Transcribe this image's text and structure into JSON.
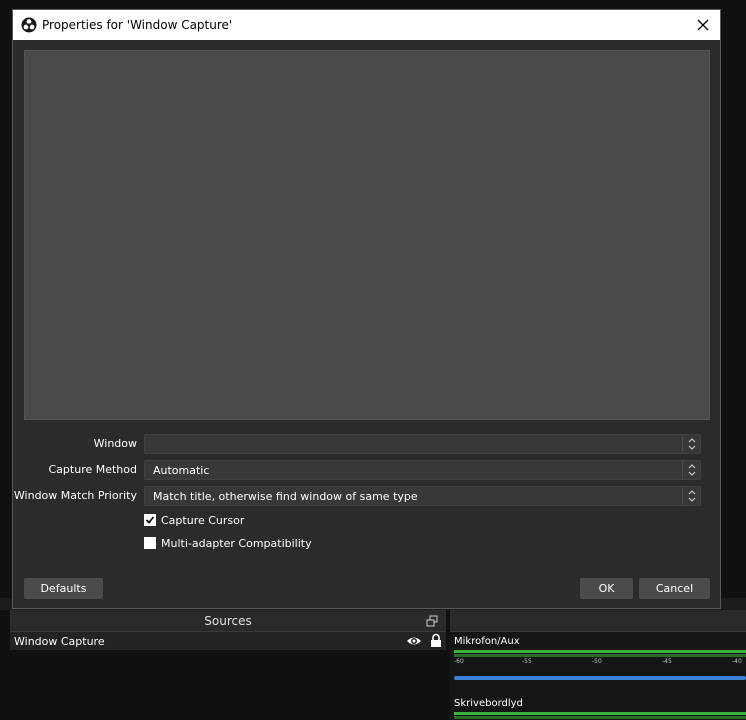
{
  "dialog": {
    "title": "Properties for 'Window Capture'",
    "app_icon": "obs-logo-icon",
    "close_icon": "close-icon",
    "fields": [
      {
        "label": "Window",
        "value": ""
      },
      {
        "label": "Capture Method",
        "value": "Automatic"
      },
      {
        "label": "Window Match Priority",
        "value": "Match title, otherwise find window of same type"
      }
    ],
    "checkboxes": [
      {
        "label": "Capture Cursor",
        "checked": true
      },
      {
        "label": "Multi-adapter Compatibility",
        "checked": false
      }
    ],
    "buttons": {
      "defaults": "Defaults",
      "ok": "OK",
      "cancel": "Cancel"
    }
  },
  "sources": {
    "title": "Sources",
    "items": [
      {
        "name": "Window Capture",
        "visible": true,
        "locked": true
      }
    ]
  },
  "mixer": {
    "tracks": [
      {
        "name": "Mikrofon/Aux",
        "ticks": [
          "-60",
          "-55",
          "-50",
          "-45",
          "-40"
        ]
      },
      {
        "name": "Skrivebordlyd"
      }
    ]
  },
  "colors": {
    "dialog_bg": "#2b2b2b",
    "preview_bg": "#4a4a4a",
    "input_bg": "#383838",
    "button_bg": "#4b4b4b",
    "meter_green": "#3cb13c",
    "volume_blue": "#3c82d8"
  }
}
